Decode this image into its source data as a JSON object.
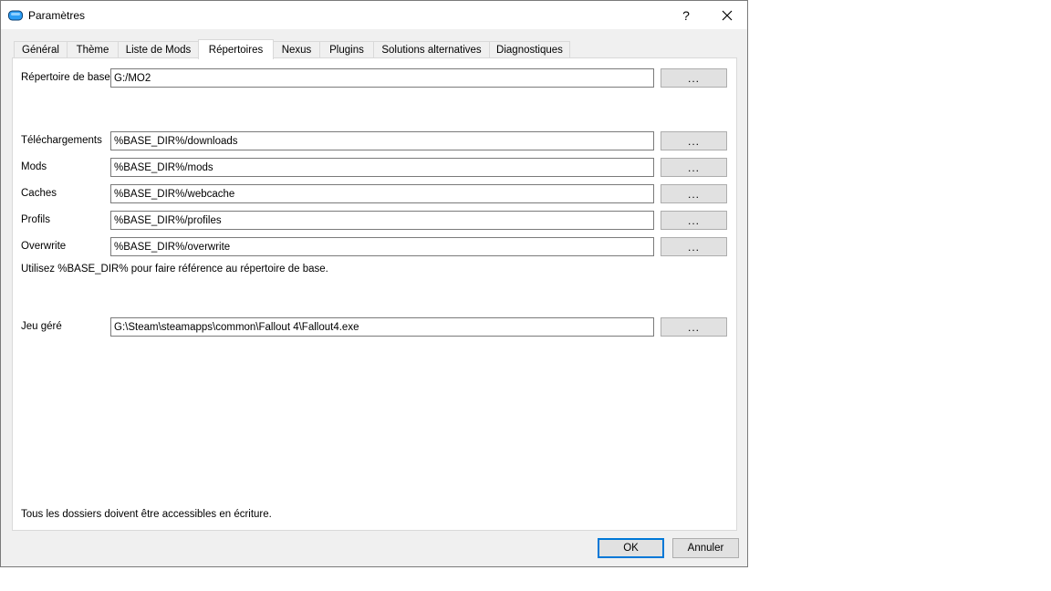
{
  "window": {
    "title": "Paramètres",
    "help_label": "?",
    "close_label": "✕"
  },
  "tabs": [
    {
      "label": "Général",
      "active": false
    },
    {
      "label": "Thème",
      "active": false
    },
    {
      "label": "Liste de Mods",
      "active": false
    },
    {
      "label": "Répertoires",
      "active": true
    },
    {
      "label": "Nexus",
      "active": false
    },
    {
      "label": "Plugins",
      "active": false
    },
    {
      "label": "Solutions alternatives",
      "active": false
    },
    {
      "label": "Diagnostiques",
      "active": false
    }
  ],
  "base_dir": {
    "label": "Répertoire de base",
    "value": "G:/MO2",
    "browse_label": "..."
  },
  "paths": [
    {
      "label": "Téléchargements",
      "value": "%BASE_DIR%/downloads",
      "browse_label": "..."
    },
    {
      "label": "Mods",
      "value": "%BASE_DIR%/mods",
      "browse_label": "..."
    },
    {
      "label": "Caches",
      "value": "%BASE_DIR%/webcache",
      "browse_label": "..."
    },
    {
      "label": "Profils",
      "value": "%BASE_DIR%/profiles",
      "browse_label": "..."
    },
    {
      "label": "Overwrite",
      "value": "%BASE_DIR%/overwrite",
      "browse_label": "..."
    }
  ],
  "base_dir_hint": "Utilisez %BASE_DIR% pour faire référence au répertoire de base.",
  "managed_game": {
    "label": "Jeu géré",
    "value": "G:\\Steam\\steamapps\\common\\Fallout 4\\Fallout4.exe",
    "browse_label": "..."
  },
  "footer_note": "Tous les dossiers doivent être accessibles en écriture.",
  "buttons": {
    "ok": "OK",
    "cancel": "Annuler"
  },
  "colors": {
    "accent": "#0078d7",
    "icon_blue": "#1e90ff"
  }
}
